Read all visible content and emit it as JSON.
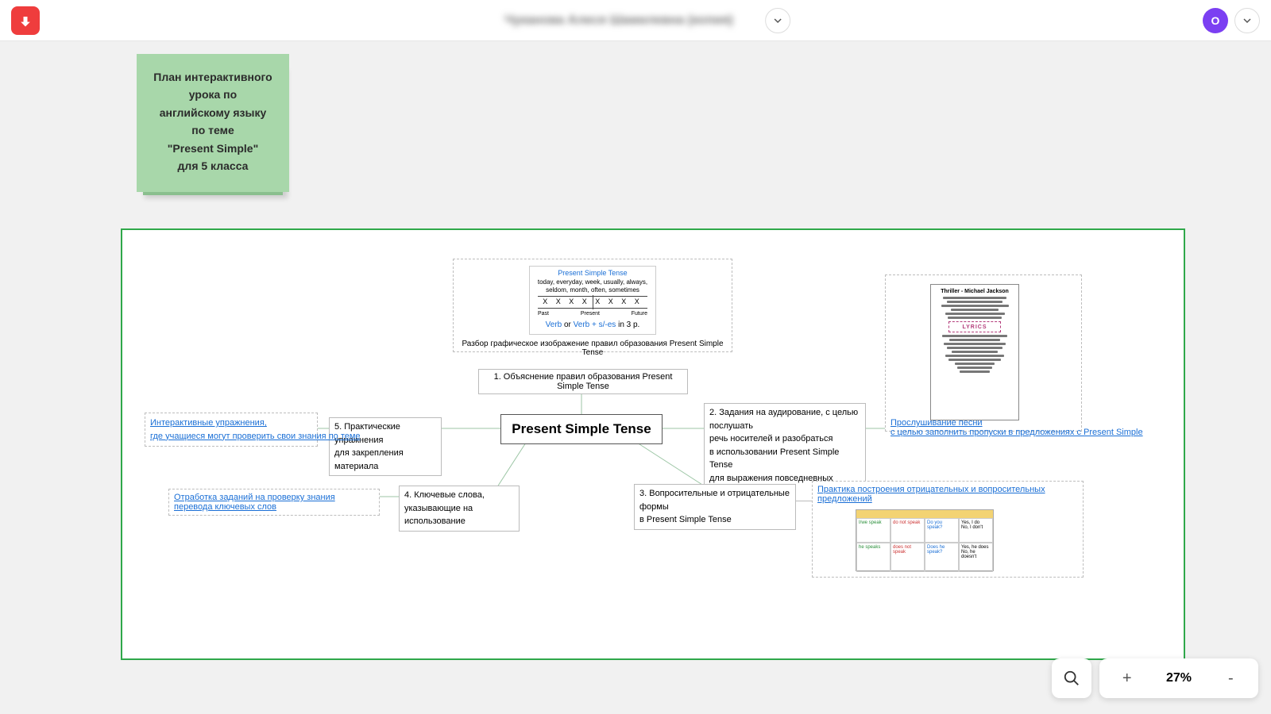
{
  "header": {
    "doc_title": "Чуканова Алеся Шамилевна (копия)",
    "avatar_initial": "О"
  },
  "sticky": {
    "l1": "План интерактивного",
    "l2": "урока по",
    "l3": "английскому языку",
    "l4": "по теме",
    "l5": "\"Present Simple\"",
    "l6": "для 5 класса"
  },
  "mindmap": {
    "central": "Present Simple Tense",
    "rules_thumb": {
      "title": "Present Simple Tense",
      "adverbs": "today, everyday, week, usually, always, seldom, month, often, sometimes",
      "x_row": "X  X  X  X  X  X  X  X",
      "past": "Past",
      "present": "Present",
      "future": "Future",
      "verb_line_a": "Verb",
      "verb_line_or": " or ",
      "verb_line_b": "Verb + s/-es",
      "verb_line_tail": " in 3 p."
    },
    "rules_caption": "Разбор графическое изображение правил образования Present Simple Tense",
    "node1": "1. Объяснение правил образования  Present Simple Tense",
    "node2_l1": "2. Задания на аудирование, с целью послушать",
    "node2_l2": "речь носителей и разобраться",
    "node2_l3": "в использовании Present Simple Tense",
    "node2_l4": "для выражения повседневных действий",
    "node2_link_l1": "Прослушивание песни",
    "node2_link_l2": "с целью заполнить пропуски в предложениях с Present Simple",
    "lyrics_title": "Thriller - Michael Jackson",
    "lyrics_badge": "LYRICS",
    "node3_l1": "3. Вопросительные и отрицательные формы",
    "node3_l2": "в Present Simple Tense",
    "node3_link": "Практика построения отрицательных и вопросительных предложений",
    "node4_l1": "4. Ключевые слова,",
    "node4_l2": "указывающие на использование",
    "node4_link": "Отработка заданий на проверку знания перевода ключевых слов",
    "node5_l1": "5. Практические упражнения",
    "node5_l2": "для закрепления материала",
    "node5_link_l1": "Интерактивные упражнения,",
    "node5_link_l2": "где учащиеся могут проверить свои знания по теме"
  },
  "zoom": {
    "plus": "+",
    "value": "27%",
    "minus": "-"
  }
}
